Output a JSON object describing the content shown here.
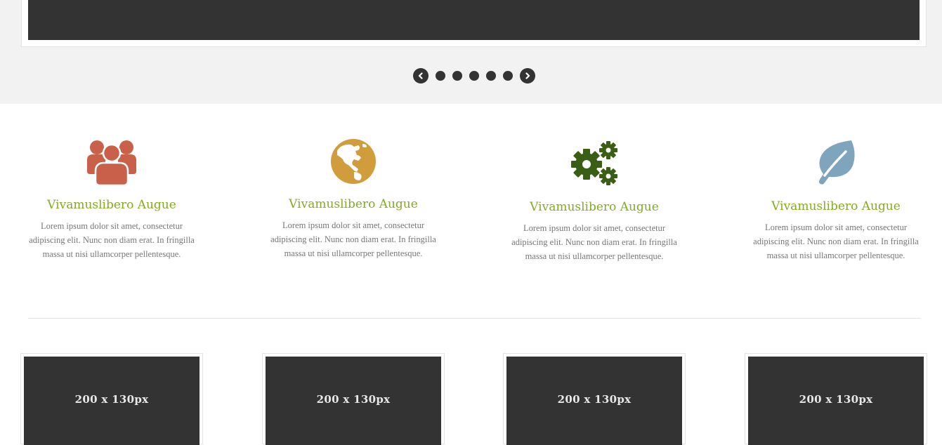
{
  "slider": {
    "dots": 5,
    "prev_icon": "chevron-left-icon",
    "next_icon": "chevron-right-icon"
  },
  "features": [
    {
      "icon": "users-icon",
      "color": "#c9614a",
      "title": "Vivamuslibero Augue",
      "text": "Lorem ipsum dolor sit amet, consectetur adipiscing elit. Nunc non diam erat. In fringilla massa ut nisi ullamcorper pellentesque."
    },
    {
      "icon": "globe-icon",
      "color": "#d09c3c",
      "title": "Vivamuslibero Augue",
      "text": "Lorem ipsum dolor sit amet, consectetur adipiscing elit. Nunc non diam erat. In fringilla massa ut nisi ullamcorper pellentesque."
    },
    {
      "icon": "gears-icon",
      "color": "#3a5e14",
      "title": "Vivamuslibero Augue",
      "text": "Lorem ipsum dolor sit amet, consectetur adipiscing elit. Nunc non diam erat. In fringilla massa ut nisi ullamcorper pellentesque."
    },
    {
      "icon": "leaf-icon",
      "color": "#7fa5bd",
      "title": "Vivamuslibero Augue",
      "text": "Lorem ipsum dolor sit amet, consectetur adipiscing elit. Nunc non diam erat. In fringilla massa ut nisi ullamcorper pellentesque."
    }
  ],
  "thumbnails": [
    {
      "label": "200 x 130px"
    },
    {
      "label": "200 x 130px"
    },
    {
      "label": "200 x 130px"
    },
    {
      "label": "200 x 130px"
    }
  ],
  "colors": {
    "accent": "#84ab20",
    "dark": "#333333",
    "band": "#f2f2f2"
  }
}
